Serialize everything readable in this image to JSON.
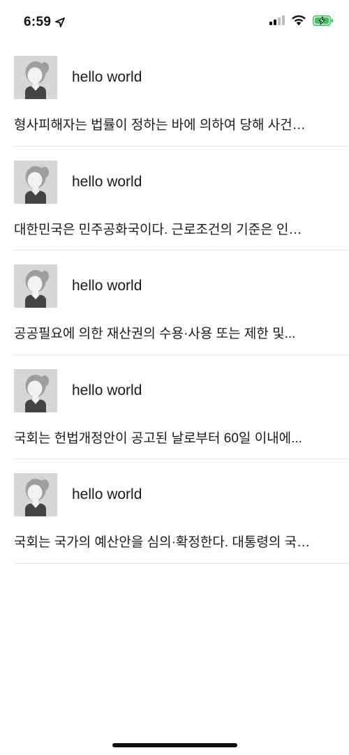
{
  "status_bar": {
    "time": "6:59",
    "icons": [
      "location-arrow-icon",
      "cellular-signal-icon",
      "wifi-icon",
      "battery-charging-icon"
    ],
    "battery_color": "#34c759"
  },
  "posts": [
    {
      "username": "hello world",
      "text": "형사피해자는 법률이 정하는 바에 의하여 당해 사건…"
    },
    {
      "username": "hello world",
      "text": "대한민국은 민주공화국이다. 근로조건의 기준은 인…"
    },
    {
      "username": "hello world",
      "text": "공공필요에 의한 재산권의 수용·사용 또는 제한 및..."
    },
    {
      "username": "hello world",
      "text": "국회는 헌법개정안이 공고된 날로부터 60일 이내에..."
    },
    {
      "username": "hello world",
      "text": "국회는 국가의 예산안을 심의·확정한다. 대통령의 국…"
    }
  ]
}
